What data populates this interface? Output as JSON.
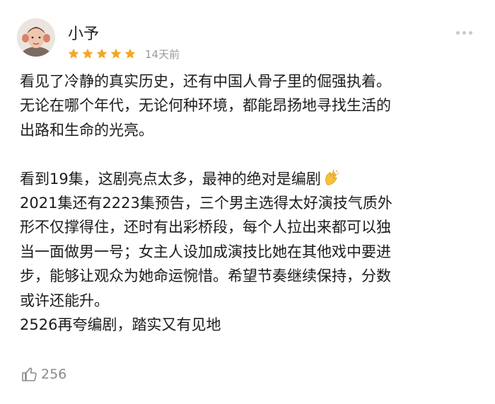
{
  "review": {
    "user": {
      "name": "小予",
      "avatar": "user-avatar"
    },
    "rating": {
      "stars": 5,
      "max": 5,
      "color": "#f5a623"
    },
    "time": "14天前",
    "lines": {
      "l1": "看见了冷静的真实历史，还有中国人骨子里的倔强执着。",
      "l2": "无论在哪个年代，无论何种环境，都能昂扬地寻找生活的",
      "l3": "出路和生命的光亮。",
      "l4": "看到19集，这剧亮点太多，最神的绝对是编剧",
      "l5": "2021集还有2223集预告，三个男主选得太好演技气质外",
      "l6": "形不仅撑得住，还时有出彩桥段，每个人拉出来都可以独",
      "l7": "当一面做男一号；女主人设加成演技比她在其他戏中要进",
      "l8": "步，能够让观众为她命运惋惜。希望节奏继续保持，分数",
      "l9": "或许还能升。",
      "l10": "2526再夸编剧，踏实又有见地"
    },
    "emoji": "clapping-hands-icon",
    "likes": "256"
  }
}
